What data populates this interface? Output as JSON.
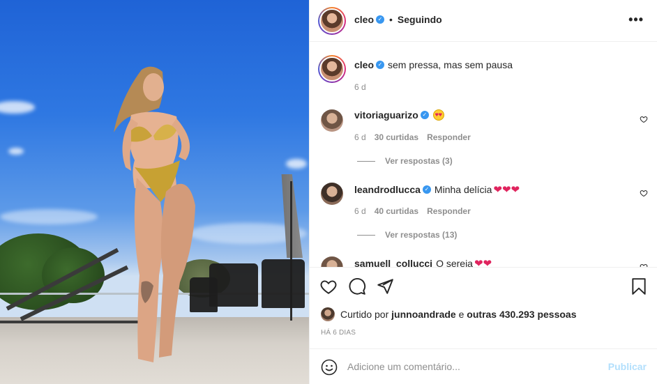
{
  "header": {
    "username": "cleo",
    "separator": "•",
    "follow_status": "Seguindo",
    "more": "•••"
  },
  "caption": {
    "username": "cleo",
    "text": "sem pressa, mas sem pausa",
    "time": "6 d"
  },
  "comments": [
    {
      "username": "vitoriaguarizo",
      "verified": true,
      "text": "",
      "emoji": "heart-eyes",
      "time": "6 d",
      "likes": "30 curtidas",
      "reply": "Responder",
      "view_replies": "Ver respostas (3)"
    },
    {
      "username": "leandrodlucca",
      "verified": true,
      "text": "Minha delícia",
      "hearts": "❤❤❤",
      "time": "6 d",
      "likes": "40 curtidas",
      "reply": "Responder",
      "view_replies": "Ver respostas (13)"
    },
    {
      "username": "samuell_collucci",
      "text": "O sereia",
      "hearts": "❤❤"
    }
  ],
  "liked_by": {
    "prefix": "Curtido por",
    "user": "junnoandrade",
    "middle": "e",
    "others": "outras 430.293 pessoas"
  },
  "date": "HÁ 6 DIAS",
  "add_comment": {
    "placeholder": "Adicione um comentário...",
    "publish": "Publicar"
  },
  "colors": {
    "verified": "#3897f0",
    "publish_disabled": "#b2dffc",
    "muted": "#8e8e8e"
  }
}
